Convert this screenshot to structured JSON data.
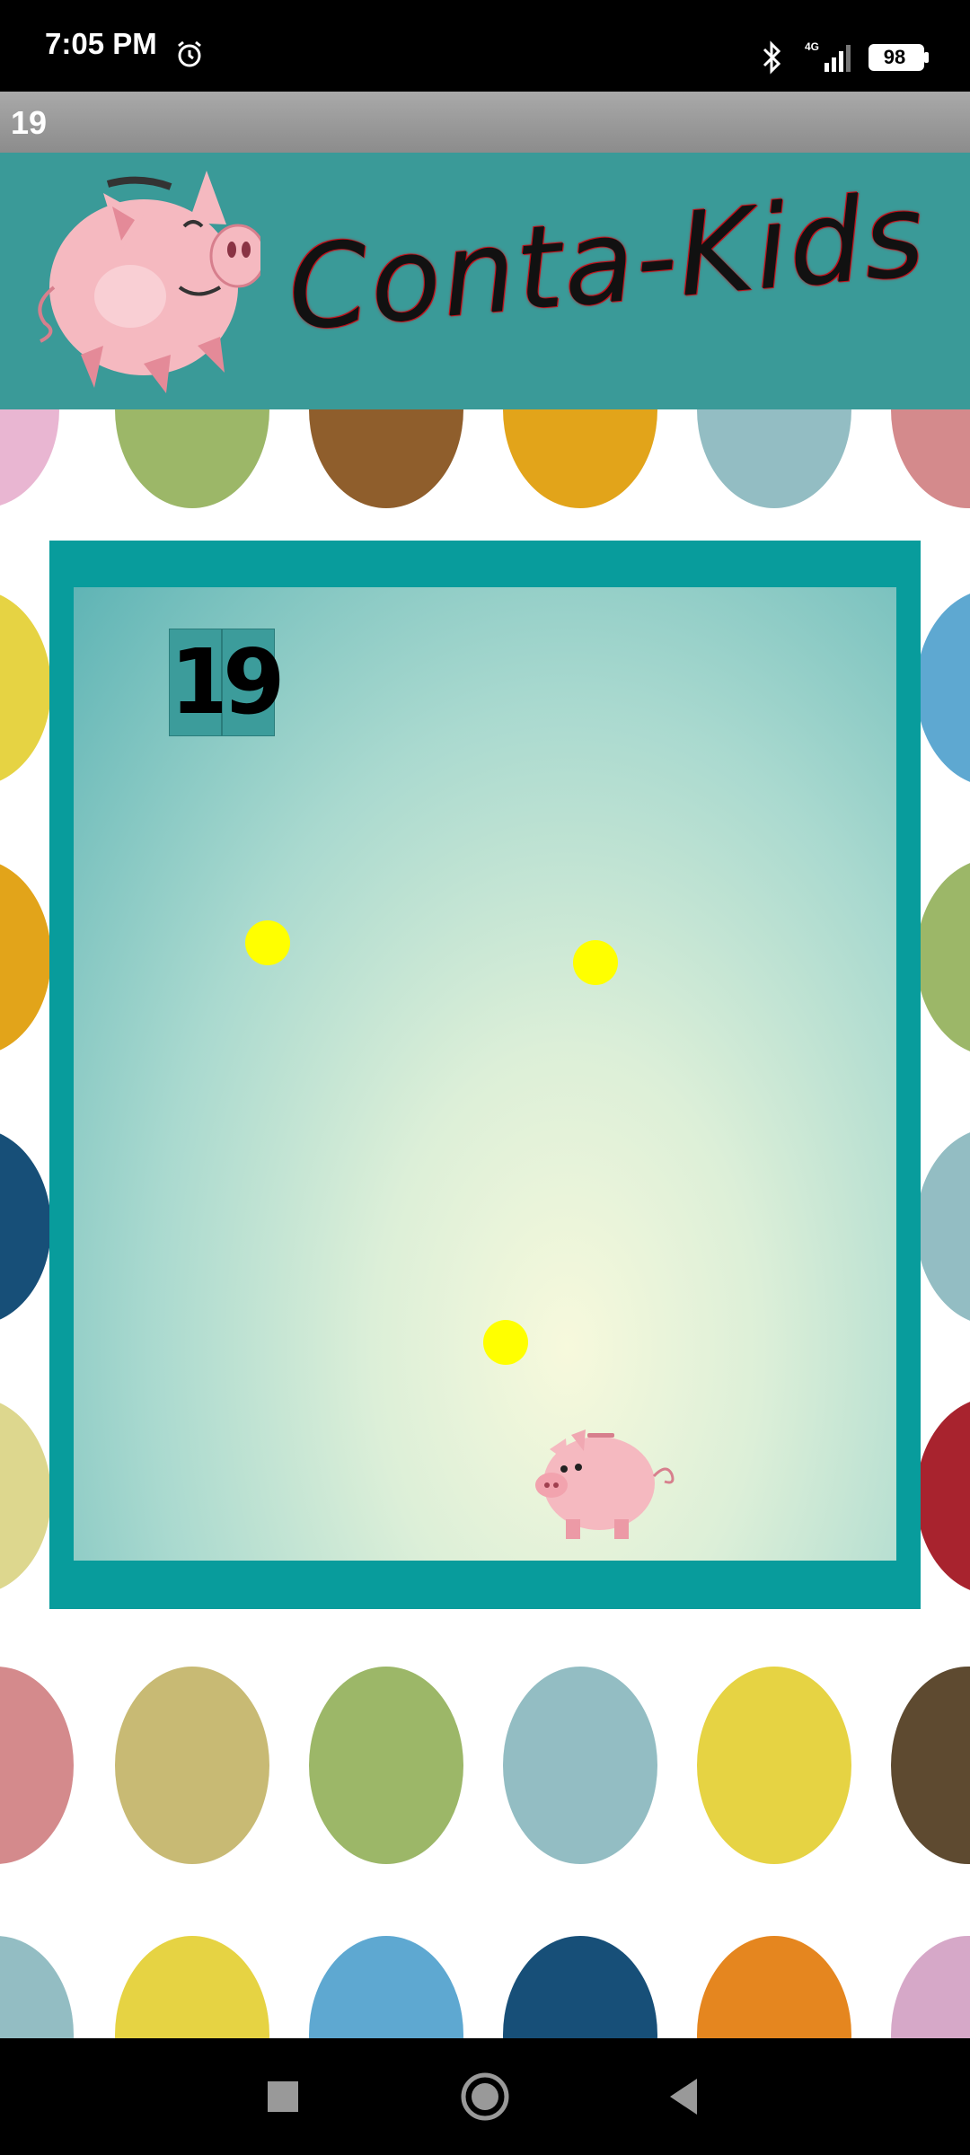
{
  "status_bar": {
    "time": "7:05 PM",
    "battery_level": "98",
    "signal_label": "4G",
    "icons": [
      "alarm-icon",
      "bluetooth-icon",
      "signal-icon",
      "battery-icon"
    ]
  },
  "app": {
    "title": "19",
    "banner_title": "Conta-Kids"
  },
  "game": {
    "score_digits": [
      "1",
      "9"
    ],
    "ball_count": 3,
    "colors": {
      "frame": "#089c9c",
      "banner": "#3a9a98",
      "ball": "#ffff00",
      "pig": "#f5b9c0"
    }
  },
  "nav_bar": {
    "buttons": [
      "recents-icon",
      "home-icon",
      "back-icon"
    ]
  }
}
